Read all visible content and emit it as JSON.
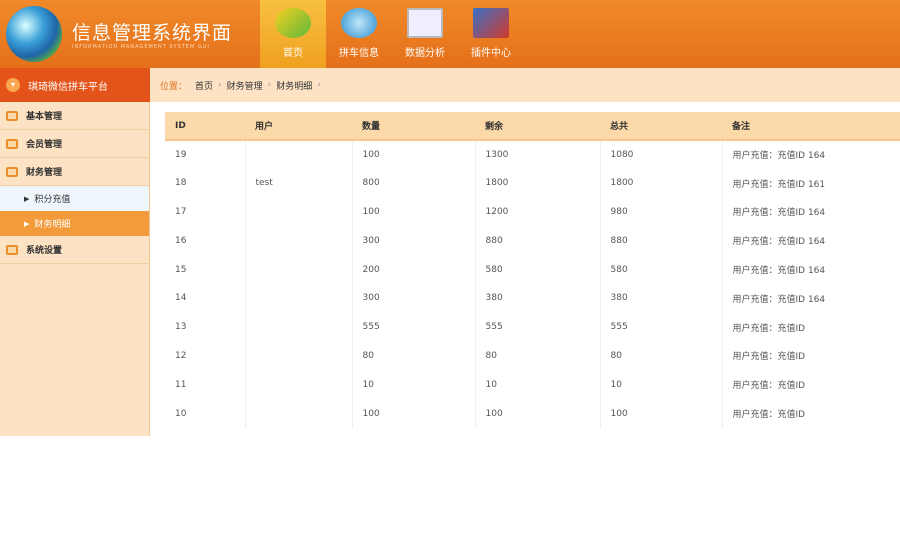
{
  "header": {
    "title": "信息管理系统界面",
    "subtitle": "INFORMATION MANAGEMENT SYSTEM GUI",
    "nav": [
      {
        "label": "首页",
        "active": true
      },
      {
        "label": "拼车信息"
      },
      {
        "label": "数据分析"
      },
      {
        "label": "插件中心"
      }
    ]
  },
  "sidebar": {
    "title": "琪琦微信拼车平台",
    "menus": [
      "基本管理",
      "会员管理",
      "财务管理",
      "系统设置"
    ],
    "submenus": [
      "积分充值",
      "财务明细"
    ]
  },
  "breadcrumb": {
    "label": "位置：",
    "items": [
      "首页",
      "财务管理",
      "财务明细"
    ]
  },
  "table": {
    "headers": [
      "ID",
      "用户",
      "数量",
      "剩余",
      "总共",
      "备注"
    ],
    "rows": [
      [
        "19",
        "",
        "100",
        "1300",
        "1080",
        "用户充值：充值ID 164"
      ],
      [
        "18",
        "test",
        "800",
        "1800",
        "1800",
        "用户充值：充值ID 161"
      ],
      [
        "17",
        "",
        "100",
        "1200",
        "980",
        "用户充值：充值ID 164"
      ],
      [
        "16",
        "",
        "300",
        "880",
        "880",
        "用户充值：充值ID 164"
      ],
      [
        "15",
        "",
        "200",
        "580",
        "580",
        "用户充值：充值ID 164"
      ],
      [
        "14",
        "",
        "300",
        "380",
        "380",
        "用户充值：充值ID 164"
      ],
      [
        "13",
        "",
        "555",
        "555",
        "555",
        "用户充值：充值ID"
      ],
      [
        "12",
        "",
        "80",
        "80",
        "80",
        "用户充值：充值ID"
      ],
      [
        "11",
        "",
        "10",
        "10",
        "10",
        "用户充值：充值ID"
      ],
      [
        "10",
        "",
        "100",
        "100",
        "100",
        "用户充值：充值ID"
      ]
    ]
  }
}
